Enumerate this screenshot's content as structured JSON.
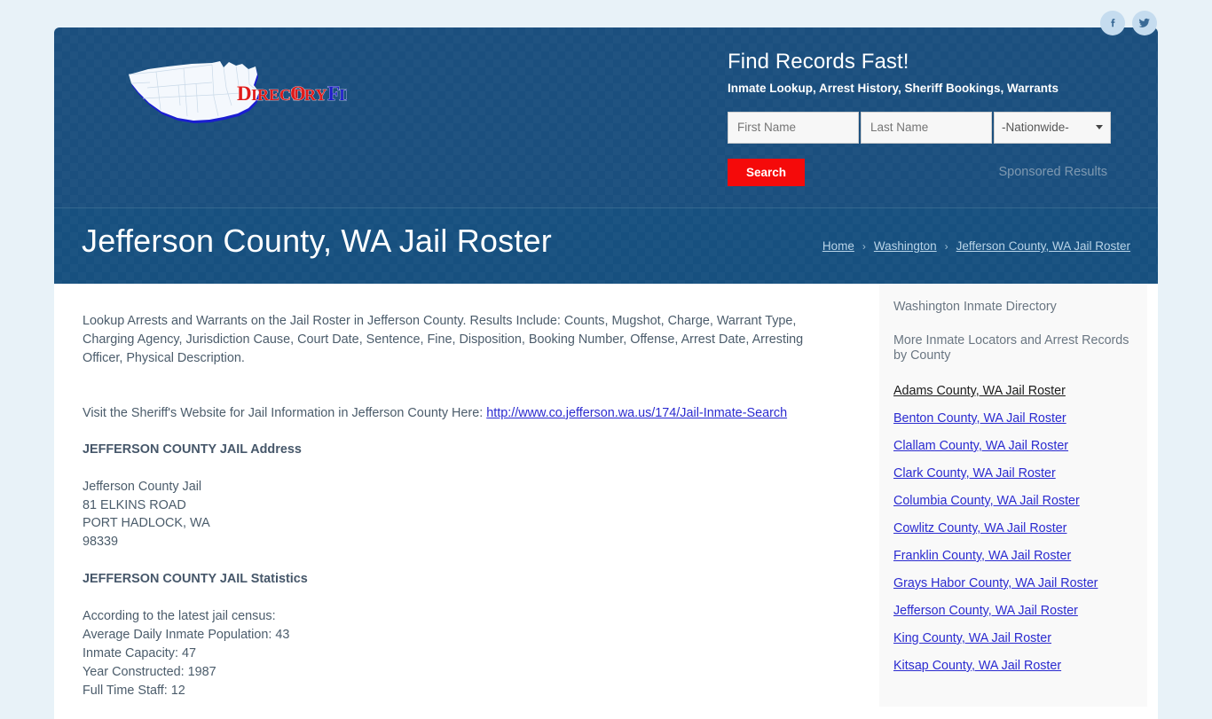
{
  "social": {
    "facebook_label": "Facebook",
    "twitter_label": "Twitter"
  },
  "header": {
    "logo_text_primary": "DIRECTORY",
    "logo_text_secondary": "FINDER",
    "title": "Find Records Fast!",
    "subtitle": "Inmate Lookup, Arrest History, Sheriff Bookings, Warrants",
    "first_name_placeholder": "First Name",
    "first_name_value": "",
    "last_name_placeholder": "Last Name",
    "last_name_value": "",
    "state_selected": "-Nationwide-",
    "search_button_label": "Search",
    "sponsored_label": "Sponsored Results",
    "colors": {
      "header_bg": "#1b4f7e",
      "search_button": "#f50a0a",
      "page_bg": "#e8f2f8"
    }
  },
  "title_band": {
    "page_title": "Jefferson County, WA Jail Roster",
    "breadcrumb": [
      {
        "label": "Home"
      },
      {
        "label": "Washington"
      },
      {
        "label": "Jefferson County, WA Jail Roster"
      }
    ],
    "separator": "›"
  },
  "main": {
    "intro": "Lookup Arrests and Warrants on the Jail Roster in Jefferson County. Results Include: Counts, Mugshot, Charge, Warrant Type, Charging Agency, Jurisdiction Cause, Court Date, Sentence, Fine, Disposition, Booking Number, Offense, Arrest Date, Arresting Officer, Physical Description.",
    "visit_prefix": "Visit the Sheriff's Website for Jail Information in Jefferson County Here: ",
    "visit_link_text": "http://www.co.jefferson.wa.us/174/Jail-Inmate-Search",
    "address_heading": "JEFFERSON COUNTY JAIL Address",
    "address_lines": [
      "Jefferson County Jail",
      "81 ELKINS ROAD",
      "PORT HADLOCK, WA",
      "98339"
    ],
    "statistics_heading": "JEFFERSON COUNTY JAIL Statistics",
    "statistics_lines": [
      "According to the latest jail census:",
      "Average Daily Inmate Population: 43",
      "Inmate Capacity: 47",
      "Year Constructed: 1987",
      "Full Time Staff: 12"
    ]
  },
  "sidebar": {
    "heading": "Washington Inmate Directory",
    "subheading": "More Inmate Locators and Arrest Records by County",
    "links": [
      {
        "label": "Adams County, WA Jail Roster",
        "visited": true
      },
      {
        "label": "Benton County, WA Jail Roster",
        "visited": false
      },
      {
        "label": "Clallam County, WA Jail Roster",
        "visited": false
      },
      {
        "label": "Clark County, WA Jail Roster",
        "visited": false
      },
      {
        "label": "Columbia County, WA Jail Roster",
        "visited": false
      },
      {
        "label": "Cowlitz County, WA Jail Roster",
        "visited": false
      },
      {
        "label": "Franklin County, WA Jail Roster",
        "visited": false
      },
      {
        "label": "Grays Habor County, WA Jail Roster",
        "visited": false
      },
      {
        "label": "Jefferson County, WA Jail Roster",
        "visited": false
      },
      {
        "label": "King County, WA Jail Roster",
        "visited": false
      },
      {
        "label": "Kitsap County, WA Jail Roster",
        "visited": false
      }
    ]
  }
}
